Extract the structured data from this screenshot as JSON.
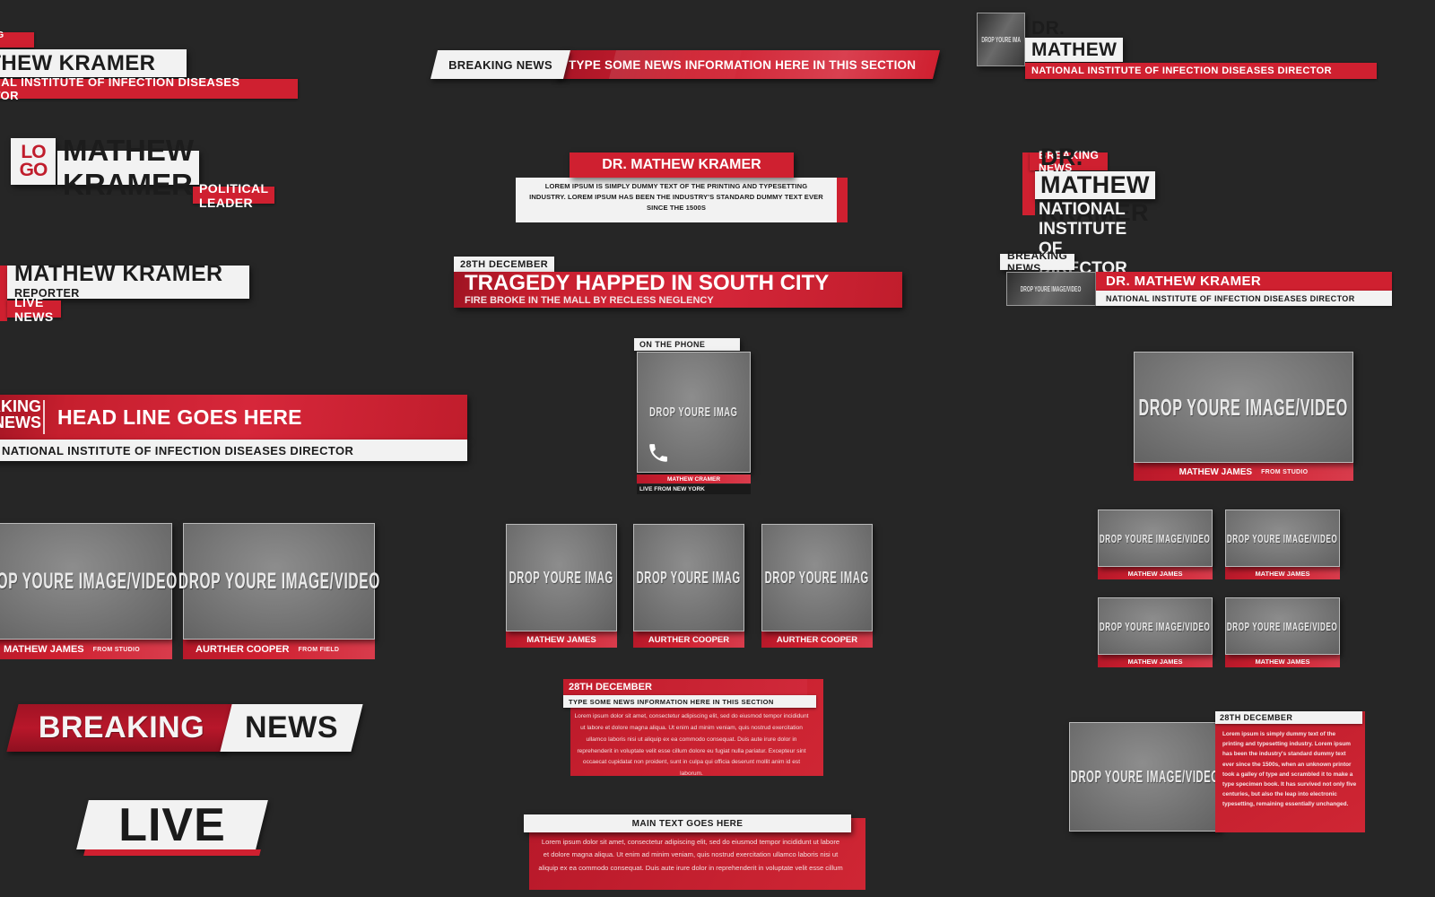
{
  "meta": {
    "background": "#262626",
    "accent_red": "#cf2030",
    "accent_white": "#f2f2f2"
  },
  "common": {
    "image_placeholder": "DROP YOURE IMAGE/VIDEO",
    "image_placeholder_short": "DROP YOURE IMAG",
    "image_placeholder_tiny": "DROP YOURE IMA",
    "breaking_news": "BREAKING NEWS",
    "date_28th": "28TH DECEMBER",
    "institute_full": "NATIONAL INSTITUTE OF INFECTION DISEASES DIRECTOR",
    "from_studio": "FROM STUDIO",
    "from_field": "FROM FIELD",
    "mathew_james": "MATHEW JAMES",
    "aurther_cooper": "AURTHER COOPER",
    "news_info_line": "TYPE SOME NEWS INFORMATION HERE IN THIS SECTION"
  },
  "lower_third_1": {
    "tag": "BREAKING NEWS",
    "name": "MATHEW KRAMER",
    "role": "NATIONAL INSTITUTE OF INFECTION DISEASES DIRECTOR"
  },
  "ticker_top": {
    "label": "BREAKING NEWS",
    "message": "TYPE SOME NEWS INFORMATION HERE IN THIS SECTION"
  },
  "lower_third_topright": {
    "thumb": "DROP YOURE IMA",
    "name": "DR. MATHEW KRAMER",
    "role": "NATIONAL INSTITUTE OF INFECTION DISEASES DIRECTOR"
  },
  "lower_third_logo": {
    "logo_line1": "LO",
    "logo_line2": "GO",
    "name": "MATHEW KRAMER",
    "role": "POLITICAL LEADER"
  },
  "quote_card": {
    "title": "DR. MATHEW KRAMER",
    "body": "LOREM IPSUM IS SIMPLY DUMMY TEXT OF THE PRINTING AND TYPESETTING INDUSTRY. LOREM IPSUM HAS BEEN THE INDUSTRY'S STANDARD DUMMY TEXT EVER SINCE THE 1500S"
  },
  "lower_third_breaking_right": {
    "tag": "BREAKING NEWS",
    "name": "DR. MATHEW KRAMER",
    "role": "NATIONAL INSTITUTE OF DIRECTOR"
  },
  "lower_third_reporter": {
    "name": "MATHEW KRAMER",
    "role": "REPORTER",
    "tag": "LIVE NEWS"
  },
  "headline_tragedy": {
    "date": "28TH DECEMBER",
    "headline": "TRAGEDY HAPPED IN SOUTH CITY",
    "subhead": "FIRE BROKE IN THE MALL BY RECLESS NEGLENCY"
  },
  "lower_third_thumb_right": {
    "tag": "BREAKING NEWS",
    "thumb": "DROP YOURE IMAGE/VIDEO",
    "name": "DR. MATHEW KRAMER",
    "role": "NATIONAL INSTITUTE OF INFECTION DISEASES DIRECTOR"
  },
  "headline_banner": {
    "tag_line1": "AKING",
    "tag_line2": "NEWS",
    "headline": "HEAD LINE GOES HERE",
    "subhead": "NATIONAL INSTITUTE OF INFECTION DISEASES DIRECTOR"
  },
  "phone_card": {
    "tag": "ON THE PHONE",
    "thumb": "DROP YOURE IMAG",
    "icon": "phone-icon",
    "name": "MATHEW CRAMER",
    "location": "LIVE FROM NEW YORK"
  },
  "cards_left": [
    {
      "thumb": "DROP YOURE IMAGE/VIDEO",
      "name": "MATHEW JAMES",
      "sub": "FROM STUDIO"
    },
    {
      "thumb": "DROP YOURE IMAGE/VIDEO",
      "name": "AURTHER COOPER",
      "sub": "FROM FIELD"
    }
  ],
  "cards_center": [
    {
      "thumb": "DROP YOURE IMAG",
      "name": "MATHEW JAMES"
    },
    {
      "thumb": "DROP YOURE IMAG",
      "name": "AURTHER COOPER"
    },
    {
      "thumb": "DROP YOURE IMAG",
      "name": "AURTHER COOPER"
    }
  ],
  "card_wide_right": {
    "thumb": "DROP YOURE IMAGE/VIDEO",
    "name": "MATHEW JAMES",
    "sub": "FROM STUDIO"
  },
  "cards_grid_right": [
    {
      "thumb": "DROP YOURE IMAGE/VIDEO",
      "name": "MATHEW JAMES"
    },
    {
      "thumb": "DROP YOURE IMAGE/VIDEO",
      "name": "MATHEW JAMES"
    },
    {
      "thumb": "DROP YOURE IMAGE/VIDEO",
      "name": "MATHEW JAMES"
    },
    {
      "thumb": "DROP YOURE IMAGE/VIDEO",
      "name": "MATHEW JAMES"
    }
  ],
  "breaking_big": {
    "left": "BREAKING",
    "right": "NEWS"
  },
  "live_badge": {
    "label": "LIVE"
  },
  "article_center": {
    "date": "28TH DECEMBER",
    "subtitle": "TYPE SOME NEWS INFORMATION HERE IN THIS SECTION",
    "body": "Lorem ipsum dolor sit amet, consectetur adipiscing elit, sed do eiusmod tempor incididunt ut labore et dolore magna aliqua. Ut enim ad minim veniam, quis nostrud exercitation ullamco laboris nisi ut aliquip ex ea commodo consequat. Duis aute irure dolor in reprehenderit in voluptate velit esse cillum dolore eu fugiat nulla pariatur. Excepteur sint occaecat cupidatat non proident, sunt in culpa qui officia deserunt mollit anim id est laborum."
  },
  "main_text_block": {
    "title": "MAIN TEXT GOES HERE",
    "body": "Lorem ipsum dolor sit amet, consectetur adipiscing elit, sed do eiusmod tempor incididunt ut labore et dolore magna aliqua. Ut enim ad minim veniam, quis nostrud exercitation ullamco laboris nisi ut aliquip ex ea commodo consequat. Duis aute irure dolor in reprehenderit in voluptate velit esse cillum"
  },
  "article_right": {
    "thumb": "DROP YOURE IMAGE/VIDEO",
    "date": "28TH DECEMBER",
    "body": "Lorem ipsum is simply dummy text of the printing and typesetting industry. Lorem ipsum has been the industry's standard dummy text ever since the 1500s, when an unknown printor took a galley of type and scrambled it to make a type specimen book. It has survived not only five centuries, but also the leap into electronic typesetting, remaining essentially unchanged."
  }
}
